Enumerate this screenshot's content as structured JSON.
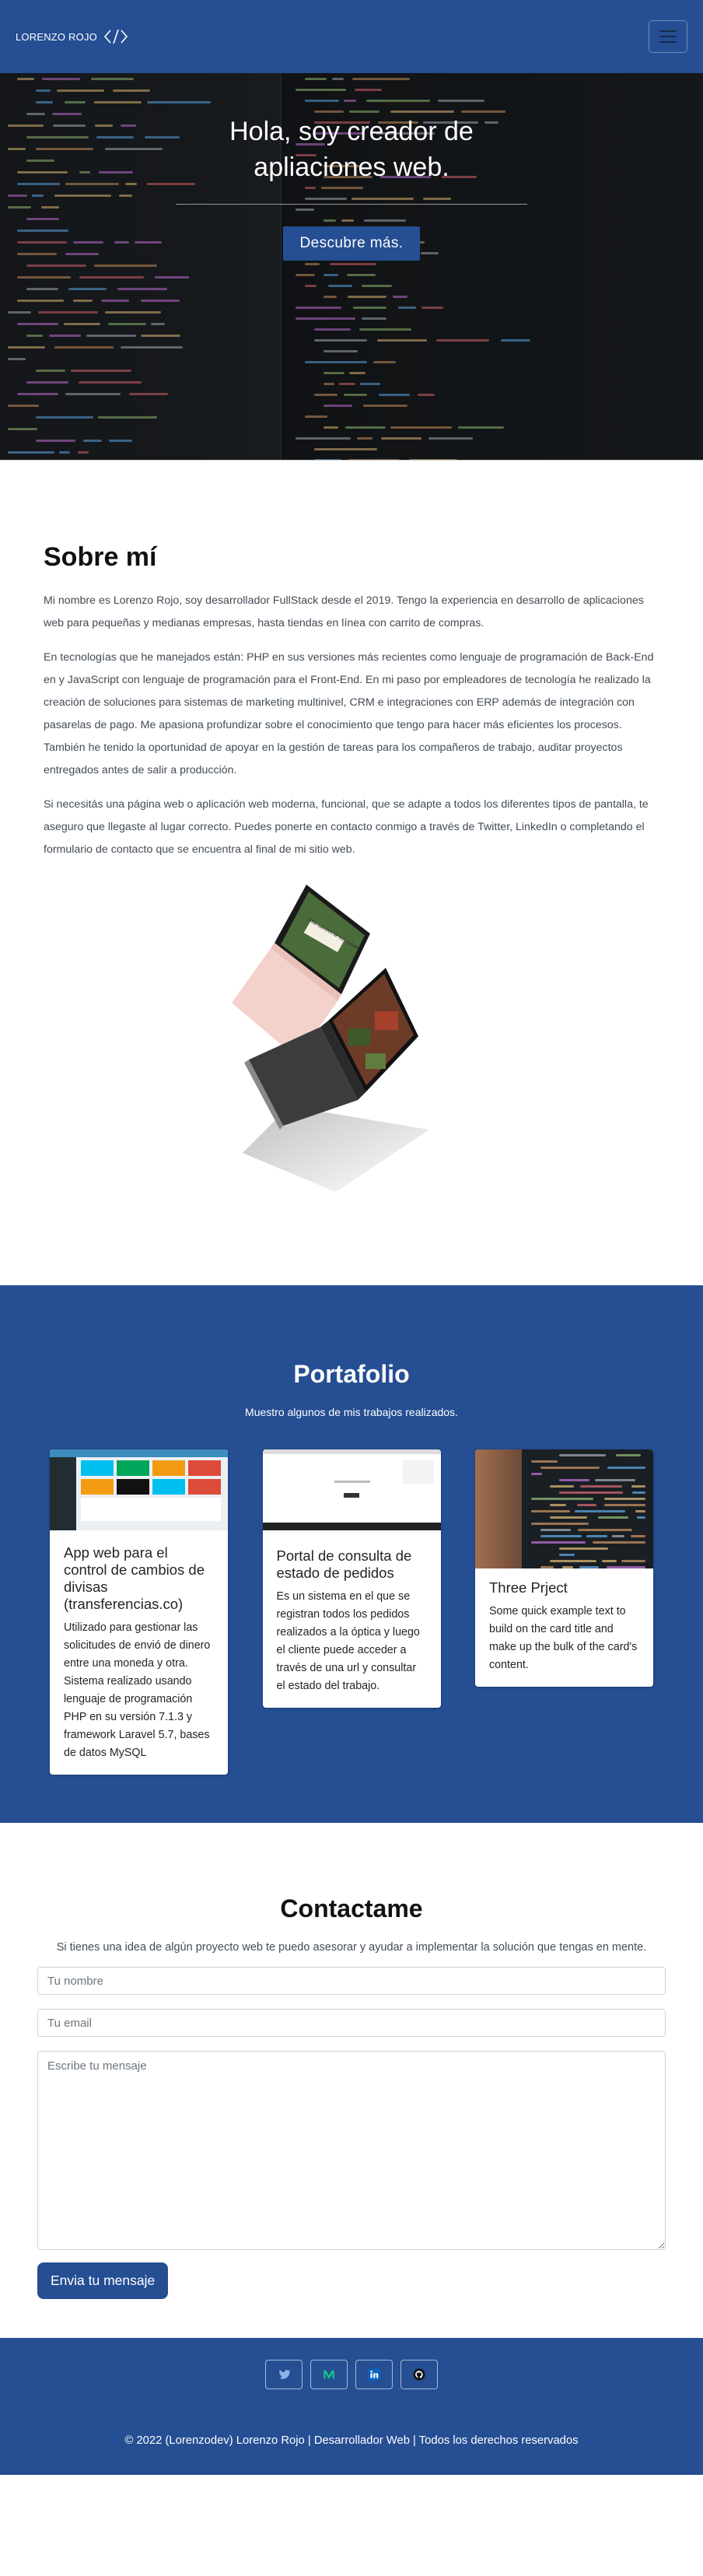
{
  "brand": {
    "name": "LORENZO ROJO",
    "icon": "code-icon"
  },
  "nav": {
    "menu_icon": "hamburger-menu-icon"
  },
  "hero": {
    "title": "Hola, soy creador de apliaciones web.",
    "button": "Descubre más."
  },
  "about": {
    "title": "Sobre mí",
    "paragraphs": [
      "Mi nombre es Lorenzo Rojo, soy desarrollador FullStack desde el 2019. Tengo la experiencia en desarrollo de aplicaciones web para pequeñas y medianas empresas, hasta tiendas en línea con carrito de compras.",
      "En tecnologías que he manejados están: PHP en sus versiones más recientes como lenguaje de programación de Back-End en y JavaScript con lenguaje de programación para el Front-End. En mi paso por empleadores de tecnología he realizado la creación de soluciones para sistemas de marketing multinivel, CRM e integraciones con ERP además de integración con pasarelas de pago. Me apasiona profundizar sobre el conocimiento que tengo para hacer más eficientes los procesos. También he tenido la oportunidad de apoyar en la gestión de tareas para los compañeros de trabajo, auditar proyectos entregados antes de salir a producción.",
      "Si necesitás una página web o aplicación web moderna, funcional, que se adapte a todos los diferentes tipos de pantalla, te aseguro que llegaste al lugar correcto. Puedes ponerte en contacto conmigo a través de Twitter, LinkedIn o completando el formulario de contacto que se encuentra al final de mi sitio web."
    ],
    "laptop_screen_text": "Más sabores de mil colores"
  },
  "portfolio": {
    "title": "Portafolio",
    "subtitle": "Muestro algunos de mis trabajos realizados.",
    "cards": [
      {
        "title": "App web para el control de cambios de divisas (transferencias.co)",
        "text": "Utilizado para gestionar las solicitudes de envió de dinero entre una moneda y otra. Sistema realizado usando lenguaje de programación PHP en su versión 7.1.3 y framework Laravel 5.7, bases de datos MySQL"
      },
      {
        "title": "Portal de consulta de estado de pedidos",
        "text": "Es un sistema en el que se registran todos los pedidos realizados a la óptica y luego el cliente puede acceder a través de una url y consultar el estado del trabajo."
      },
      {
        "title": "Three Prject",
        "text": "Some quick example text to build on the card title and make up the bulk of the card's content."
      }
    ]
  },
  "contact": {
    "title": "Contactame",
    "lead": "Si tienes una idea de algún proyecto web te puedo asesorar y ayudar a implementar la solución que tengas en mente.",
    "name_placeholder": "Tu nombre",
    "email_placeholder": "Tu email",
    "message_placeholder": "Escribe tu mensaje",
    "button": "Envia tu mensaje"
  },
  "footer": {
    "socials": [
      "twitter-icon",
      "medium-icon",
      "linkedin-icon",
      "github-icon"
    ],
    "copyright": "© 2022 (Lorenzodev) Lorenzo Rojo | Desarrollador Web | Todos los derechos reservados"
  },
  "colors": {
    "primary": "#254e93",
    "text": "#212529",
    "muted": "#424b55"
  }
}
